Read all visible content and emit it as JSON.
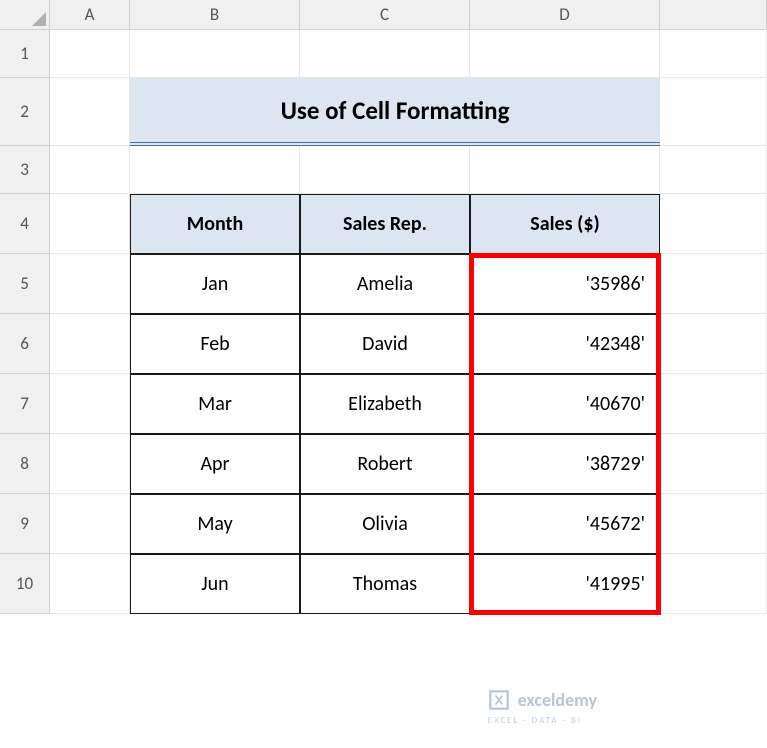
{
  "columns": [
    "A",
    "B",
    "C",
    "D"
  ],
  "rows": [
    "1",
    "2",
    "3",
    "4",
    "5",
    "6",
    "7",
    "8",
    "9",
    "10"
  ],
  "title": "Use of Cell Formatting",
  "headers": {
    "month": "Month",
    "rep": "Sales Rep.",
    "sales": "Sales ($)"
  },
  "data": [
    {
      "month": "Jan",
      "rep": "Amelia",
      "sales": "'35986'"
    },
    {
      "month": "Feb",
      "rep": "David",
      "sales": "'42348'"
    },
    {
      "month": "Mar",
      "rep": "Elizabeth",
      "sales": "'40670'"
    },
    {
      "month": "Apr",
      "rep": "Robert",
      "sales": "'38729'"
    },
    {
      "month": "May",
      "rep": "Olivia",
      "sales": "'45672'"
    },
    {
      "month": "Jun",
      "rep": "Thomas",
      "sales": "'41995'"
    }
  ],
  "watermark": {
    "main": "exceldemy",
    "sub": "EXCEL · DATA · BI"
  }
}
